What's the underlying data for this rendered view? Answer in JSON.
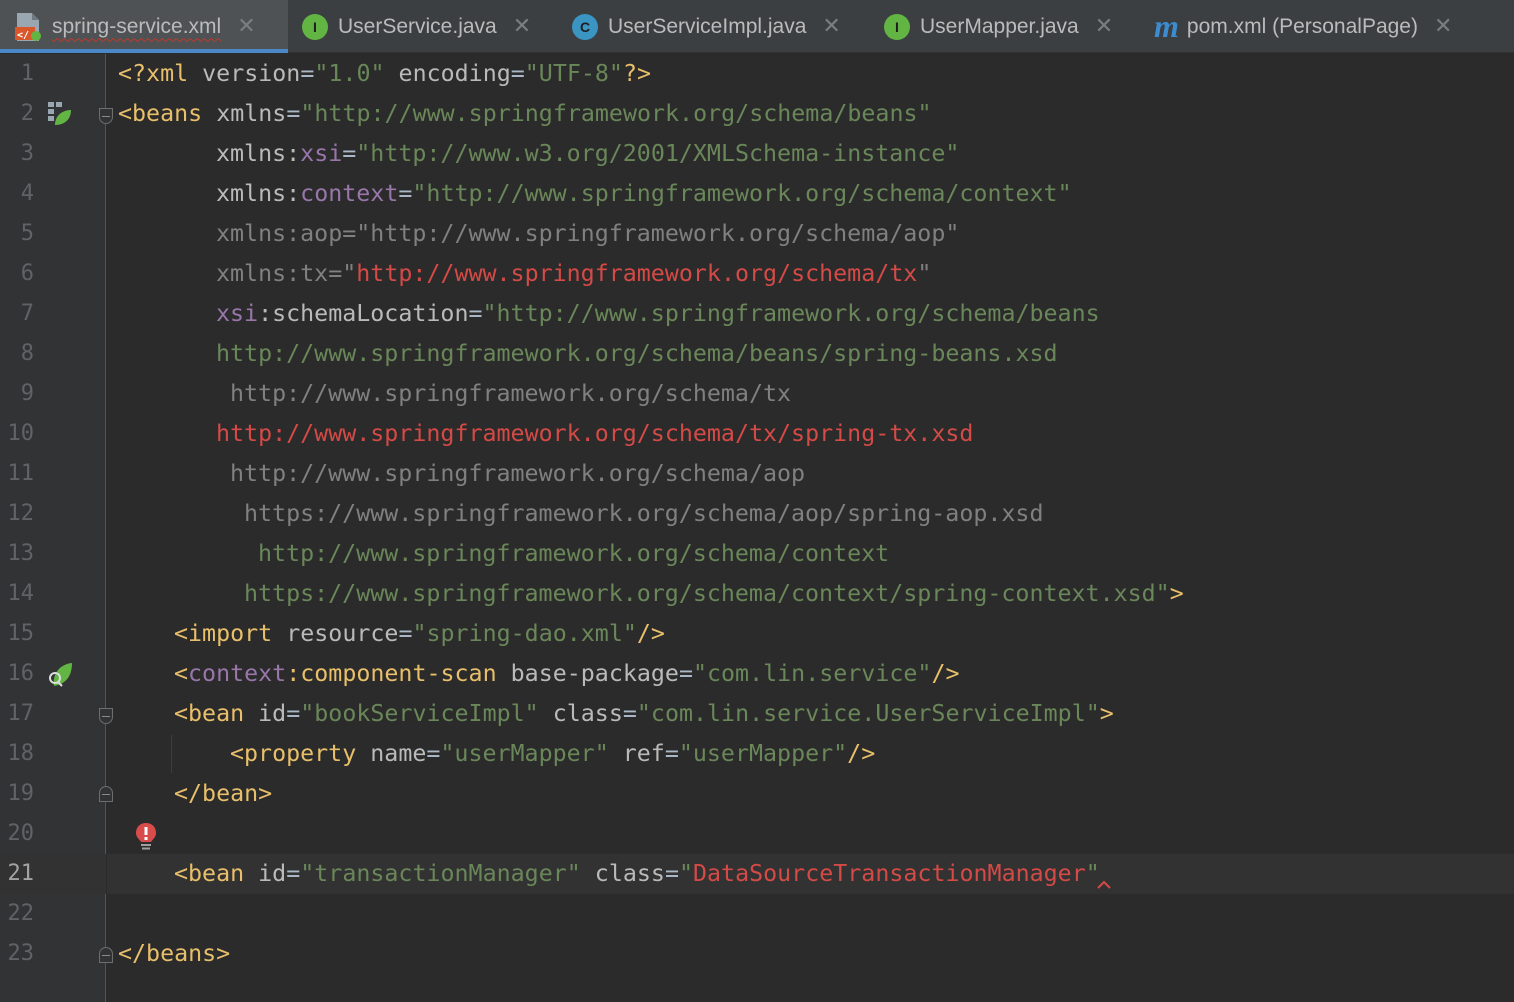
{
  "tabs": [
    {
      "label": "spring-service.xml",
      "icon": "xml-file-icon",
      "active": true
    },
    {
      "label": "UserService.java",
      "icon": "interface-icon",
      "letter": "I"
    },
    {
      "label": "UserServiceImpl.java",
      "icon": "class-icon",
      "letter": "C"
    },
    {
      "label": "UserMapper.java",
      "icon": "interface-icon",
      "letter": "I"
    },
    {
      "label": "pom.xml (PersonalPage)",
      "icon": "maven-icon",
      "letter": "m"
    }
  ],
  "close_glyph": "✕",
  "line_numbers": [
    "1",
    "2",
    "3",
    "4",
    "5",
    "6",
    "7",
    "8",
    "9",
    "10",
    "11",
    "12",
    "13",
    "14",
    "15",
    "16",
    "17",
    "18",
    "19",
    "20",
    "21",
    "22",
    "23"
  ],
  "current_line": "21",
  "gutter_icons": [
    "spring-bean-icon",
    "spring-scan-icon",
    "error-bulb-icon"
  ],
  "colors": {
    "background": "#2b2b2b",
    "tag": "#e8bf6a",
    "attribute": "#bababa",
    "namespace": "#9876aa",
    "value": "#6a8759",
    "error": "#d44a46",
    "unused": "#808080",
    "accent": "#4a88c7"
  },
  "code": {
    "l1": [
      "<?xml ",
      "version",
      "=",
      "\"1.0\"",
      " encoding",
      "=",
      "\"UTF-8\"",
      "?>"
    ],
    "l2": [
      "<beans ",
      "xmlns",
      "=",
      "\"http://www.springframework.org/schema/beans\""
    ],
    "l3": [
      "xmlns",
      ":",
      "xsi",
      "=",
      "\"http://www.w3.org/2001/XMLSchema-instance\""
    ],
    "l4": [
      "xmlns",
      ":",
      "context",
      "=",
      "\"http://www.springframework.org/schema/context\""
    ],
    "l5": [
      "xmlns:aop=\"http://www.springframework.org/schema/aop\""
    ],
    "l6": [
      "xmlns:tx=\"",
      "http://www.springframework.org/schema/tx",
      "\""
    ],
    "l7": [
      "xsi",
      ":schemaLocation",
      "=",
      "\"http://www.springframework.org/schema/beans"
    ],
    "l8": [
      "http://www.springframework.org/schema/beans/spring-beans.xsd"
    ],
    "l9": [
      "http://www.springframework.org/schema/tx"
    ],
    "l10": [
      "http://www.springframework.org/schema/tx/spring-tx.xsd"
    ],
    "l11": [
      "http://www.springframework.org/schema/aop"
    ],
    "l12": [
      "https://www.springframework.org/schema/aop/spring-aop.xsd"
    ],
    "l13": [
      "http://www.springframework.org/schema/context"
    ],
    "l14": [
      "https://www.springframework.org/schema/context/spring-context.xsd\"",
      ">"
    ],
    "l15": [
      "<import ",
      "resource",
      "=",
      "\"spring-dao.xml\"",
      "/>"
    ],
    "l16": [
      "<",
      "context",
      ":component-scan ",
      "base-package",
      "=",
      "\"com.lin.service\"",
      "/>"
    ],
    "l17": [
      "<bean ",
      "id",
      "=",
      "\"bookServiceImpl\"",
      " class",
      "=",
      "\"com.lin.service.UserServiceImpl\"",
      ">"
    ],
    "l18": [
      "<property ",
      "name",
      "=",
      "\"userMapper\"",
      " ref",
      "=",
      "\"userMapper\"",
      "/>"
    ],
    "l19": [
      "</bean>"
    ],
    "l21": [
      "<bean ",
      "id",
      "=",
      "\"transactionManager\"",
      " class",
      "=",
      "\"",
      "DataSourceTransactionManager",
      "\""
    ],
    "l23": [
      "</beans>"
    ]
  }
}
